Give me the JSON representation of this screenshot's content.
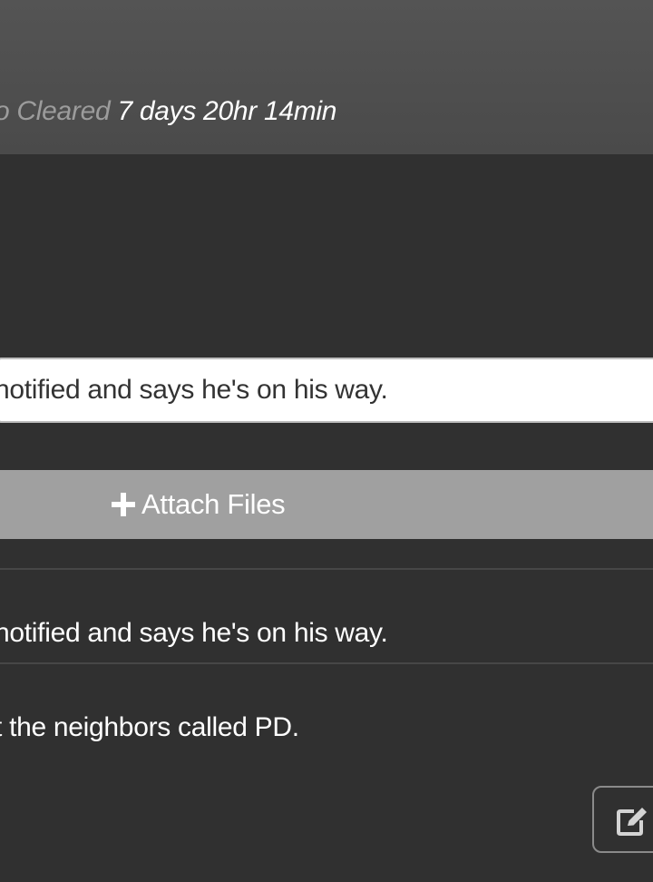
{
  "header": {
    "label": "o Cleared",
    "value": "7 days 20hr 14min"
  },
  "note_input": {
    "value": "notified and says he's on his way."
  },
  "attach_button": {
    "label": "Attach Files",
    "icon": "plus-icon"
  },
  "log": {
    "entries": [
      {
        "text": "notified and says he's on his way."
      },
      {
        "text": "t the neighbors called PD."
      }
    ]
  },
  "edit_button": {
    "icon": "edit-icon"
  },
  "colors": {
    "background": "#303030",
    "header": "#4e4e4e",
    "button": "#a0a0a0",
    "label_muted": "#9c9c9c",
    "text": "#ffffff"
  }
}
